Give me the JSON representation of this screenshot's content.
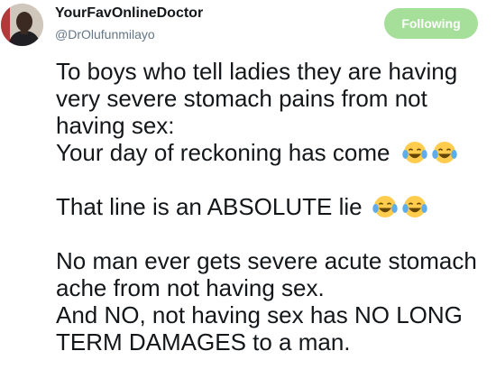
{
  "tweet": {
    "display_name": "YourFavOnlineDoctor",
    "handle": "@DrOlufunmilayo",
    "follow_button_label": "Following",
    "follow_button_color": "#a5df99",
    "text_lines": [
      "To boys who tell ladies they are having",
      "very severe stomach pains from not",
      "having sex:",
      "Your day of reckoning has come",
      "",
      "That line is an ABSOLUTE lie",
      "",
      "No man ever gets severe acute stomach",
      "ache from not having sex.",
      "And NO, not having sex has NO LONG",
      "TERM DAMAGES to a man."
    ],
    "emoji_icon": "face-with-tears-of-joy-icon"
  }
}
